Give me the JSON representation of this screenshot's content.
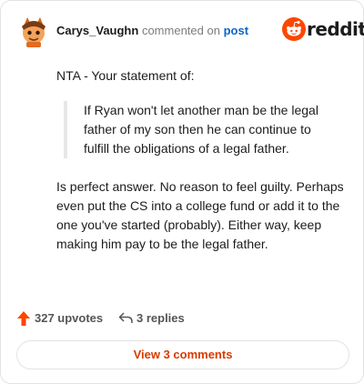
{
  "header": {
    "username": "Carys_Vaughn",
    "commented_text": "commented on",
    "post_link": "post",
    "logo_text": "reddit"
  },
  "comment": {
    "intro": "NTA - Your statement of:",
    "quote": "If Ryan won't let another man be the legal father of my son then he can continue to fulfill the obligations of a legal father.",
    "body": "Is perfect answer. No reason to feel guilty. Perhaps even put the CS into a college fund or add it to the one you've started (probably). Either way, keep making him pay to be the legal father."
  },
  "actions": {
    "upvotes": "327 upvotes",
    "replies": "3 replies"
  },
  "view_button": "View 3 comments",
  "colors": {
    "brand": "#ff4500",
    "view_text": "#d93a00",
    "link": "#0a66c2"
  }
}
